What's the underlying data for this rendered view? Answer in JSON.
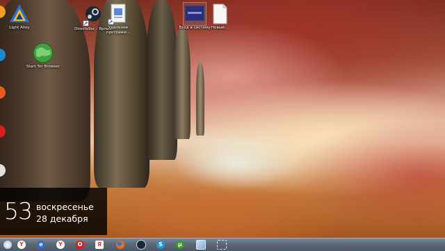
{
  "desktop": {
    "icons": [
      {
        "id": "light-alloy",
        "label": "Light Alloy"
      },
      {
        "id": "tor-browser",
        "label": "Start Tor Browser"
      },
      {
        "id": "shortcut",
        "label": "Directx9sc - Ярлык"
      },
      {
        "id": "uninstall",
        "label": "Удаление программ..."
      },
      {
        "id": "system-login",
        "label": "Вход в систему"
      },
      {
        "id": "new-text",
        "label": "Новый..."
      }
    ]
  },
  "clock": {
    "minutes": "53",
    "weekday": "воскресенье",
    "date": "28 декабря"
  },
  "taskbar": {
    "items": [
      {
        "icon": "start-orb-icon",
        "label": "Y"
      },
      {
        "icon": "yandex-icon",
        "label": "Y"
      },
      {
        "icon": "ie-icon",
        "label": "e"
      },
      {
        "icon": "yandex-browser-icon",
        "label": "Y"
      },
      {
        "icon": "opera-icon",
        "label": "O"
      },
      {
        "icon": "yandex-store-icon",
        "label": "Я"
      },
      {
        "icon": "firefox-icon",
        "label": ""
      },
      {
        "icon": "steam-icon",
        "label": ""
      },
      {
        "icon": "skype-icon",
        "label": "S"
      },
      {
        "icon": "utorrent-icon",
        "label": "µ"
      },
      {
        "icon": "window-icon",
        "label": ""
      },
      {
        "icon": "snip-icon",
        "label": ""
      }
    ]
  },
  "colors": {
    "taskbar": "#5d6877",
    "clock_bg": "#000000",
    "skype": "#1a9ad6",
    "yandex_red": "#e8332a",
    "utorrent": "#3a9b2e",
    "ie": "#2f6fc9"
  }
}
